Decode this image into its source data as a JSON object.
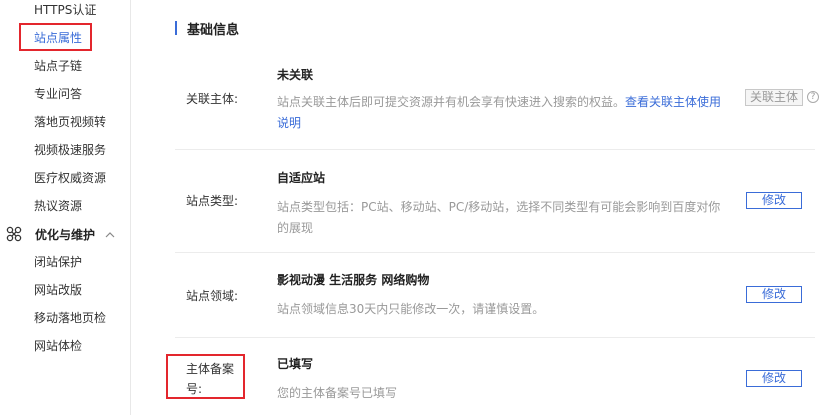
{
  "sidebar": {
    "items_top": [
      {
        "label": "HTTPS认证"
      },
      {
        "label": "站点属性"
      },
      {
        "label": "站点子链"
      },
      {
        "label": "专业问答"
      },
      {
        "label": "落地页视频转"
      },
      {
        "label": "视频极速服务"
      },
      {
        "label": "医疗权威资源"
      },
      {
        "label": "热议资源"
      }
    ],
    "group": {
      "label": "优化与维护",
      "icon": "network-icon"
    },
    "items_bottom": [
      {
        "label": "闭站保护"
      },
      {
        "label": "网站改版"
      },
      {
        "label": "移动落地页检"
      },
      {
        "label": "网站体检"
      }
    ],
    "active_color": "#3a6cd8"
  },
  "main": {
    "section_title": "基础信息",
    "rows": [
      {
        "label": "关联主体:",
        "value": "未关联",
        "desc": "站点关联主体后即可提交资源并有机会享有快速进入搜索的权益。",
        "link": "查看关联主体使用说明",
        "button": "关联主体"
      },
      {
        "label": "站点类型:",
        "value": "自适应站",
        "desc": "站点类型包括：PC站、移动站、PC/移动站，选择不同类型有可能会影响到百度对你的展现",
        "button": "修改"
      },
      {
        "label": "站点领域:",
        "value": "影视动漫 生活服务 网络购物",
        "desc": "站点领域信息30天内只能修改一次，请谨慎设置。",
        "button": "修改"
      },
      {
        "label_line1": "主体备案",
        "label_line2": "号:",
        "value": "已填写",
        "desc": "您的主体备案号已填写",
        "button": "修改"
      }
    ],
    "highlight_color": "#e3262d"
  }
}
